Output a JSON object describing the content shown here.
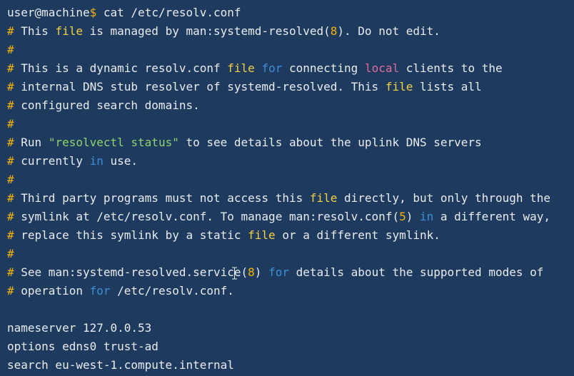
{
  "prompt": {
    "user_host": "user@machine",
    "symbol": "$",
    "command": "cat",
    "argument": "/etc/resolv.conf"
  },
  "lines": [
    [
      {
        "t": "hash",
        "v": "#"
      },
      {
        "t": "text",
        "v": " This "
      },
      {
        "t": "kw-file",
        "v": "file"
      },
      {
        "t": "text",
        "v": " is managed by man:systemd-resolved("
      },
      {
        "t": "num",
        "v": "8"
      },
      {
        "t": "text",
        "v": "). Do not edit."
      }
    ],
    [
      {
        "t": "hash",
        "v": "#"
      }
    ],
    [
      {
        "t": "hash",
        "v": "#"
      },
      {
        "t": "text",
        "v": " This is a dynamic resolv.conf "
      },
      {
        "t": "kw-file",
        "v": "file"
      },
      {
        "t": "text",
        "v": " "
      },
      {
        "t": "kw-for",
        "v": "for"
      },
      {
        "t": "text",
        "v": " connecting "
      },
      {
        "t": "kw-local",
        "v": "local"
      },
      {
        "t": "text",
        "v": " clients to the"
      }
    ],
    [
      {
        "t": "hash",
        "v": "#"
      },
      {
        "t": "text",
        "v": " internal DNS stub resolver of systemd-resolved. This "
      },
      {
        "t": "kw-file",
        "v": "file"
      },
      {
        "t": "text",
        "v": " lists all"
      }
    ],
    [
      {
        "t": "hash",
        "v": "#"
      },
      {
        "t": "text",
        "v": " configured search domains."
      }
    ],
    [
      {
        "t": "hash",
        "v": "#"
      }
    ],
    [
      {
        "t": "hash",
        "v": "#"
      },
      {
        "t": "text",
        "v": " Run "
      },
      {
        "t": "str",
        "v": "\"resolvectl status\""
      },
      {
        "t": "text",
        "v": " to see details about the uplink DNS servers"
      }
    ],
    [
      {
        "t": "hash",
        "v": "#"
      },
      {
        "t": "text",
        "v": " currently "
      },
      {
        "t": "kw-for",
        "v": "in"
      },
      {
        "t": "text",
        "v": " use."
      }
    ],
    [
      {
        "t": "hash",
        "v": "#"
      }
    ],
    [
      {
        "t": "hash",
        "v": "#"
      },
      {
        "t": "text",
        "v": " Third party programs must not access this "
      },
      {
        "t": "kw-file",
        "v": "file"
      },
      {
        "t": "text",
        "v": " directly, but only through the"
      }
    ],
    [
      {
        "t": "hash",
        "v": "#"
      },
      {
        "t": "text",
        "v": " symlink at /etc/resolv.conf. To manage man:resolv.conf("
      },
      {
        "t": "num",
        "v": "5"
      },
      {
        "t": "text",
        "v": ") "
      },
      {
        "t": "kw-for",
        "v": "in"
      },
      {
        "t": "text",
        "v": " a different way,"
      }
    ],
    [
      {
        "t": "hash",
        "v": "#"
      },
      {
        "t": "text",
        "v": " replace this symlink by a static "
      },
      {
        "t": "kw-file",
        "v": "file"
      },
      {
        "t": "text",
        "v": " or a different symlink."
      }
    ],
    [
      {
        "t": "hash",
        "v": "#"
      }
    ],
    [
      {
        "t": "hash",
        "v": "#"
      },
      {
        "t": "text",
        "v": " See man:systemd-resolved.service("
      },
      {
        "t": "num",
        "v": "8"
      },
      {
        "t": "text",
        "v": ") "
      },
      {
        "t": "kw-for",
        "v": "for"
      },
      {
        "t": "text",
        "v": " details about the supported modes of"
      }
    ],
    [
      {
        "t": "hash",
        "v": "#"
      },
      {
        "t": "text",
        "v": " operation "
      },
      {
        "t": "kw-for",
        "v": "for"
      },
      {
        "t": "text",
        "v": " /etc/resolv.conf."
      }
    ],
    [],
    [
      {
        "t": "text",
        "v": "nameserver 127.0.0.53"
      }
    ],
    [
      {
        "t": "text",
        "v": "options edns0 trust-ad"
      }
    ],
    [
      {
        "t": "text",
        "v": "search eu-west-1.compute.internal"
      }
    ]
  ],
  "colors": {
    "background": "#1f3a5f",
    "foreground": "#e8ecef",
    "comment_hash": "#f4b400",
    "keyword_file": "#f4d03f",
    "keyword_for_in": "#3b8fd6",
    "keyword_local": "#e06c9f",
    "string": "#8fd36c"
  },
  "cursor": {
    "icon": "text-ibeam-cursor-icon"
  }
}
